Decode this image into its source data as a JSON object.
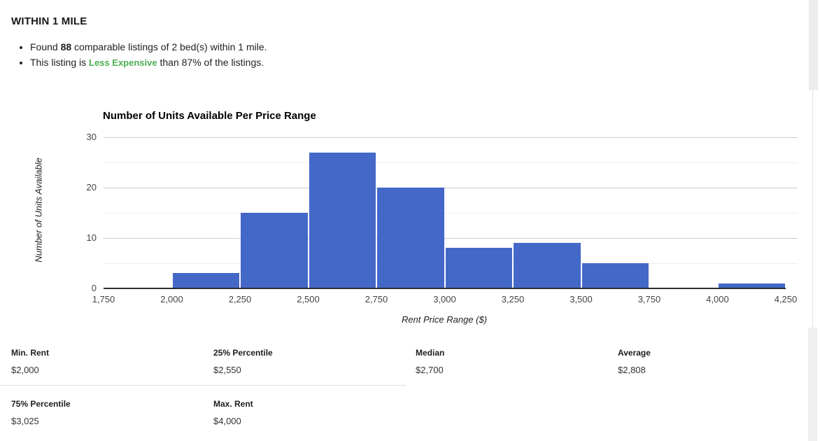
{
  "section": {
    "title": "WITHIN 1 MILE",
    "bullets": [
      {
        "pre": "Found ",
        "strong": "88",
        "post": " comparable listings of 2 bed(s) within 1 mile."
      },
      {
        "pre": "This listing is ",
        "strong": "Less Expensive",
        "post": " than 87% of the listings."
      }
    ]
  },
  "colors": {
    "highlight_green": "#4caf50",
    "bar_blue": "#4368c8"
  },
  "chart_data": {
    "type": "bar",
    "title": "Number of Units Available Per Price Range",
    "xlabel": "Rent Price Range ($)",
    "ylabel": "Number of Units Available",
    "bar_color": "#4368c8",
    "grid": "on",
    "xlim": [
      1750,
      4250
    ],
    "ylim": [
      0,
      30
    ],
    "x_tick_labels": [
      "1,750",
      "2,000",
      "2,250",
      "2,500",
      "2,750",
      "3,000",
      "3,250",
      "3,500",
      "3,750",
      "4,000",
      "4,250"
    ],
    "x_tick_values": [
      1750,
      2000,
      2250,
      2500,
      2750,
      3000,
      3250,
      3500,
      3750,
      4000,
      4250
    ],
    "y_ticks": [
      0,
      10,
      20,
      30
    ],
    "y_minor_gridlines": [
      5,
      15,
      25
    ],
    "bins": [
      {
        "from": 2000,
        "to": 2250,
        "count": 3
      },
      {
        "from": 2250,
        "to": 2500,
        "count": 15
      },
      {
        "from": 2500,
        "to": 2750,
        "count": 27
      },
      {
        "from": 2750,
        "to": 3000,
        "count": 20
      },
      {
        "from": 3000,
        "to": 3250,
        "count": 8
      },
      {
        "from": 3250,
        "to": 3500,
        "count": 9
      },
      {
        "from": 3500,
        "to": 3750,
        "count": 5
      },
      {
        "from": 4000,
        "to": 4250,
        "count": 1
      }
    ],
    "total_units": 88
  },
  "stats": {
    "rows": [
      [
        {
          "label": "Min. Rent",
          "value": "$2,000"
        },
        {
          "label": "25% Percentile",
          "value": "$2,550"
        },
        {
          "label": "Median",
          "value": "$2,700"
        },
        {
          "label": "Average",
          "value": "$2,808"
        }
      ],
      [
        {
          "label": "75% Percentile",
          "value": "$3,025"
        },
        {
          "label": "Max. Rent",
          "value": "$4,000"
        }
      ]
    ]
  }
}
